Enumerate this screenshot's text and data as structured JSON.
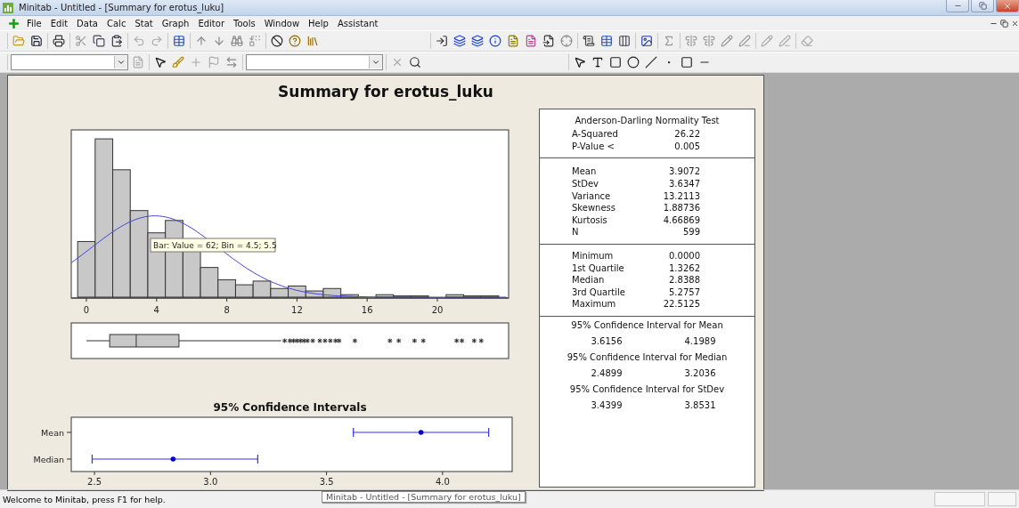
{
  "window": {
    "title": "Minitab - Untitled - [Summary for erotus_luku]"
  },
  "menu": [
    "File",
    "Edit",
    "Data",
    "Calc",
    "Stat",
    "Graph",
    "Editor",
    "Tools",
    "Window",
    "Help",
    "Assistant"
  ],
  "graph": {
    "title": "Summary for erotus_luku",
    "histogram": {
      "x_ticks": [
        "0",
        "4",
        "8",
        "12",
        "16",
        "20"
      ],
      "tooltip": "Bar: Value = 62; Bin = 4.5; 5.5"
    },
    "stats_table": {
      "title": "Anderson-Darling Normality Test",
      "normality_rows": [
        {
          "label": "A-Squared",
          "value": "26.22"
        },
        {
          "label": "P-Value <",
          "value": "0.005"
        }
      ],
      "descriptive_rows": [
        {
          "label": "Mean",
          "value": "3.9072"
        },
        {
          "label": "StDev",
          "value": "3.6347"
        },
        {
          "label": "Variance",
          "value": "13.2113"
        },
        {
          "label": "Skewness",
          "value": "1.88736"
        },
        {
          "label": "Kurtosis",
          "value": "4.66869"
        },
        {
          "label": "N",
          "value": "599"
        }
      ],
      "quartile_rows": [
        {
          "label": "Minimum",
          "value": "0.0000"
        },
        {
          "label": "1st Quartile",
          "value": "1.3262"
        },
        {
          "label": "Median",
          "value": "2.8388"
        },
        {
          "label": "3rd Quartile",
          "value": "5.2757"
        },
        {
          "label": "Maximum",
          "value": "22.5125"
        }
      ],
      "confidence_intervals": [
        {
          "title": "95% Confidence Interval for Mean",
          "lower": "3.6156",
          "upper": "4.1989"
        },
        {
          "title": "95% Confidence Interval for Median",
          "lower": "2.4899",
          "upper": "3.2036"
        },
        {
          "title": "95% Confidence Interval for StDev",
          "lower": "3.4399",
          "upper": "3.8531"
        }
      ]
    },
    "ci_plot": {
      "title": "95% Confidence Intervals",
      "categories": [
        "Mean",
        "Median"
      ],
      "x_ticks": [
        "2.5",
        "3.0",
        "3.5",
        "4.0"
      ]
    }
  },
  "status_bar": {
    "message": "Welcome to Minitab, press F1 for help.",
    "tooltip": "Minitab - Untitled - [Summary for erotus_luku]"
  }
}
